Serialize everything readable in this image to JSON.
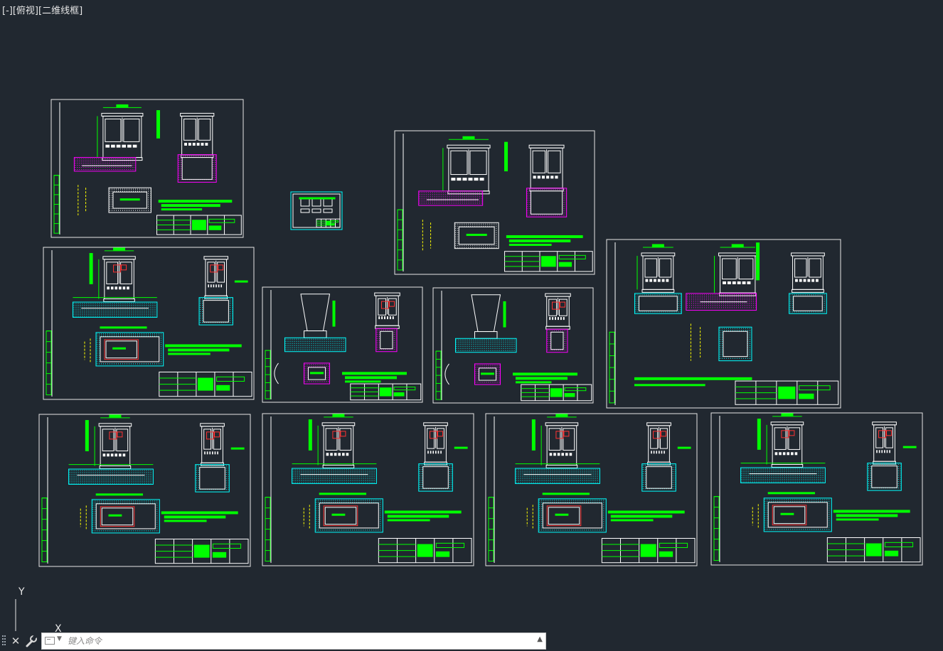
{
  "viewport": {
    "controls_label": "[-]",
    "view_label": "[俯视]",
    "style_label": "[二维线框]"
  },
  "ucs": {
    "y_label": "Y",
    "x_label": "X"
  },
  "command_line": {
    "placeholder": "键入命令",
    "close_glyph": "✕",
    "history_glyph": "▲"
  },
  "colors": {
    "background": "#212830",
    "sheet_border": "#e6e6e6",
    "line_green": "#00ff00",
    "line_cyan": "#00ffff",
    "line_magenta": "#ff00ff",
    "line_yellow": "#ffff00",
    "line_red": "#ff3333",
    "line_white": "#ffffff"
  }
}
